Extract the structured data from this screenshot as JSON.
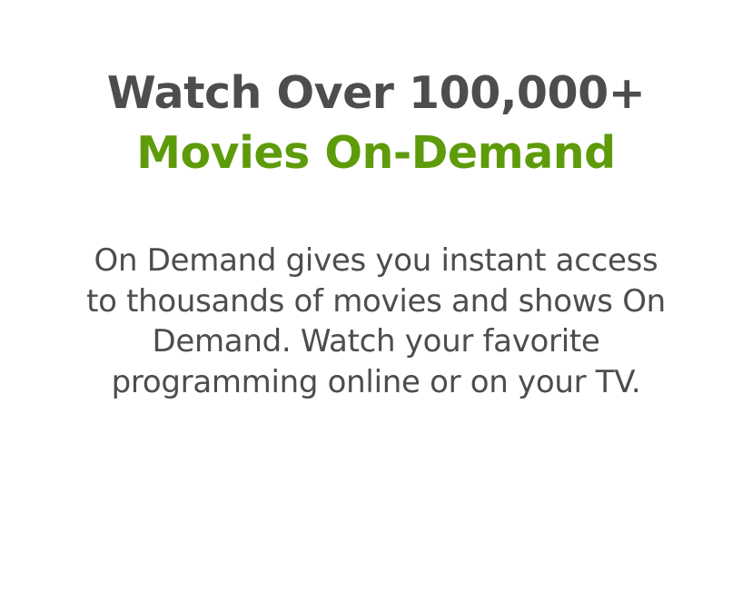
{
  "hero": {
    "headline_line1": "Watch Over 100,000+",
    "headline_line2": "Movies On-Demand",
    "description_lines": [
      "On Demand gives you instant access",
      "to thousands of movies and shows On",
      "Demand. Watch your favorite",
      "programming online or on your TV."
    ]
  },
  "colors": {
    "text_primary": "#4d4d4d",
    "accent_green": "#5e9b0a",
    "background": "#ffffff"
  }
}
